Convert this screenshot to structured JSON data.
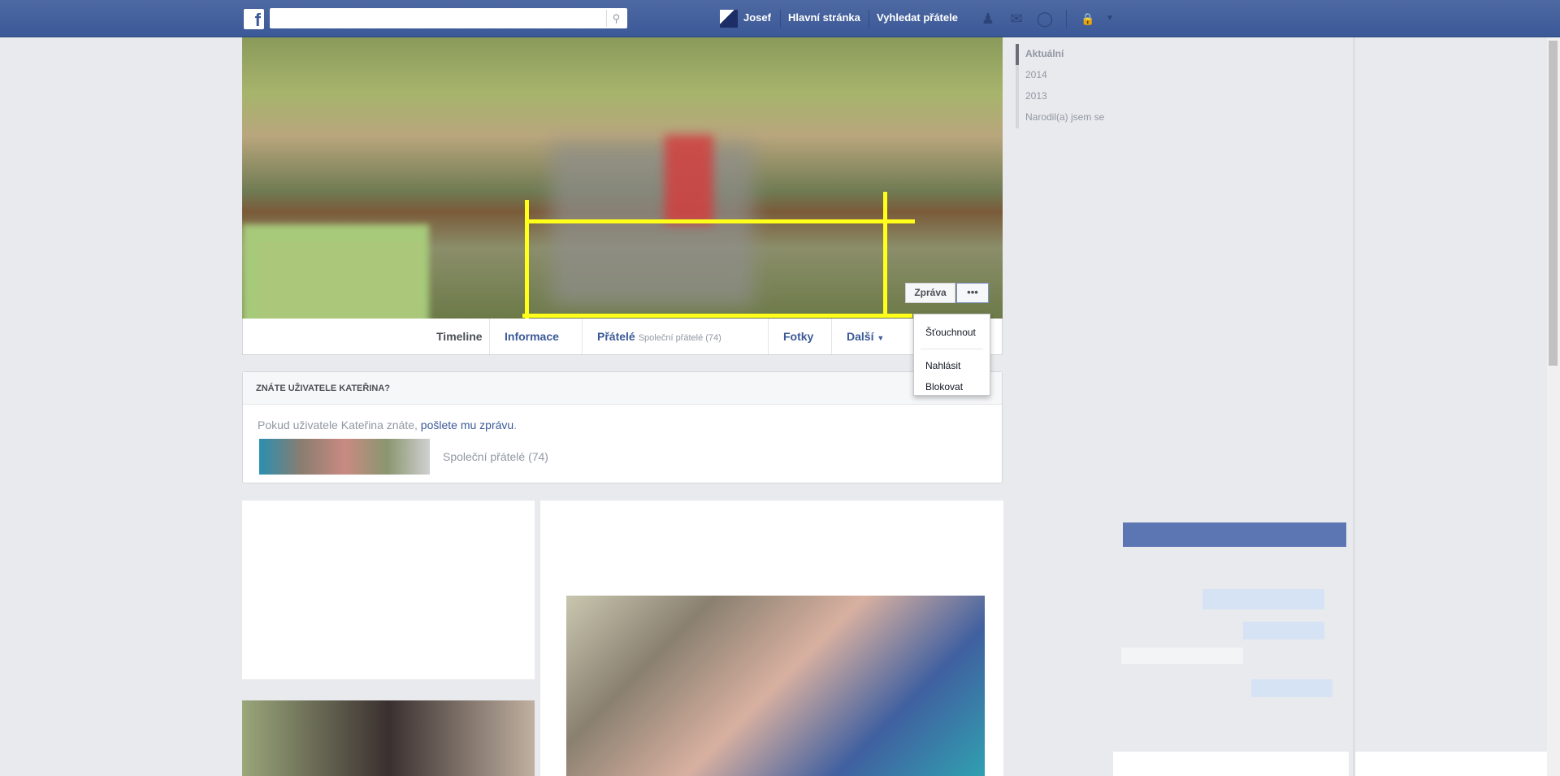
{
  "topbar": {
    "user_name": "Josef",
    "home": "Hlavní stránka",
    "find_friends": "Vyhledat přátele",
    "search_placeholder": "",
    "logo": "f"
  },
  "profile": {
    "message_button": "Zpráva",
    "more_button": "•••",
    "tabs": [
      {
        "label": "Timeline"
      },
      {
        "label": "Informace"
      },
      {
        "label": "Přátelé",
        "sub": "Společní přátelé (74)"
      },
      {
        "label": "Fotky"
      },
      {
        "label": "Další"
      }
    ]
  },
  "dropdown": {
    "items": [
      "Šťouchnout",
      "Nahlásit",
      "Blokovat"
    ]
  },
  "know_card": {
    "title": "ZNÁTE UŽIVATELE KATEŘINA?",
    "text": "Pokud uživatele Kateřina znáte, ",
    "link": "pošlete mu zprávu",
    "text_end": ".",
    "mutual": "Společní přátelé (74)"
  },
  "timeline_nav": [
    "Aktuální",
    "2014",
    "2013",
    "Narodil(a) jsem se"
  ],
  "colors": {
    "brand": "#3b5998",
    "annotation": "#ffff1a"
  }
}
